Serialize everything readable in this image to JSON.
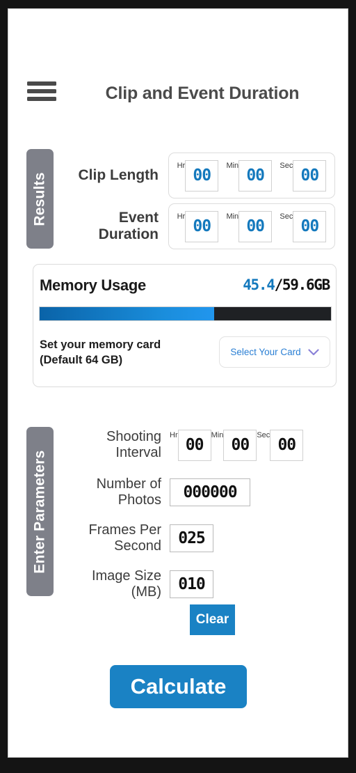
{
  "header": {
    "menu_icon": "hamburger-icon",
    "title": "Clip and Event Duration"
  },
  "results": {
    "tab_label": "Results",
    "rows": [
      {
        "label": "Clip Length",
        "units": [
          {
            "unit": "Hr",
            "value": "00"
          },
          {
            "unit": "Min",
            "value": "00"
          },
          {
            "unit": "Sec",
            "value": "00"
          }
        ]
      },
      {
        "label": "Event Duration",
        "units": [
          {
            "unit": "Hr",
            "value": "00"
          },
          {
            "unit": "Min",
            "value": "00"
          },
          {
            "unit": "Sec",
            "value": "00"
          }
        ]
      }
    ]
  },
  "memory": {
    "title": "Memory Usage",
    "used": "45.4",
    "total": "/59.6GB",
    "percent": 60,
    "set_card_label": "Set your memory card\n(Default 64 GB)",
    "select_label": "Select Your Card",
    "chevron_icon": "chevron-down-icon",
    "accent_blue": "#1479bd",
    "chevron_color": "#8b82d8",
    "track_color": "#1f2124"
  },
  "parameters": {
    "tab_label": "Enter Parameters",
    "interval": {
      "label": "Shooting Interval",
      "units": [
        {
          "unit": "Hr",
          "value": "00"
        },
        {
          "unit": "Min",
          "value": "00"
        },
        {
          "unit": "Sec",
          "value": "00"
        }
      ]
    },
    "photos": {
      "label": "Number of Photos",
      "value": "000000"
    },
    "fps": {
      "label": "Frames Per Second",
      "value": "025"
    },
    "image_size": {
      "label": "Image Size (MB)",
      "value": "010"
    },
    "clear_label": "Clear"
  },
  "actions": {
    "calculate_label": "Calculate",
    "button_color": "#1a82c4"
  }
}
